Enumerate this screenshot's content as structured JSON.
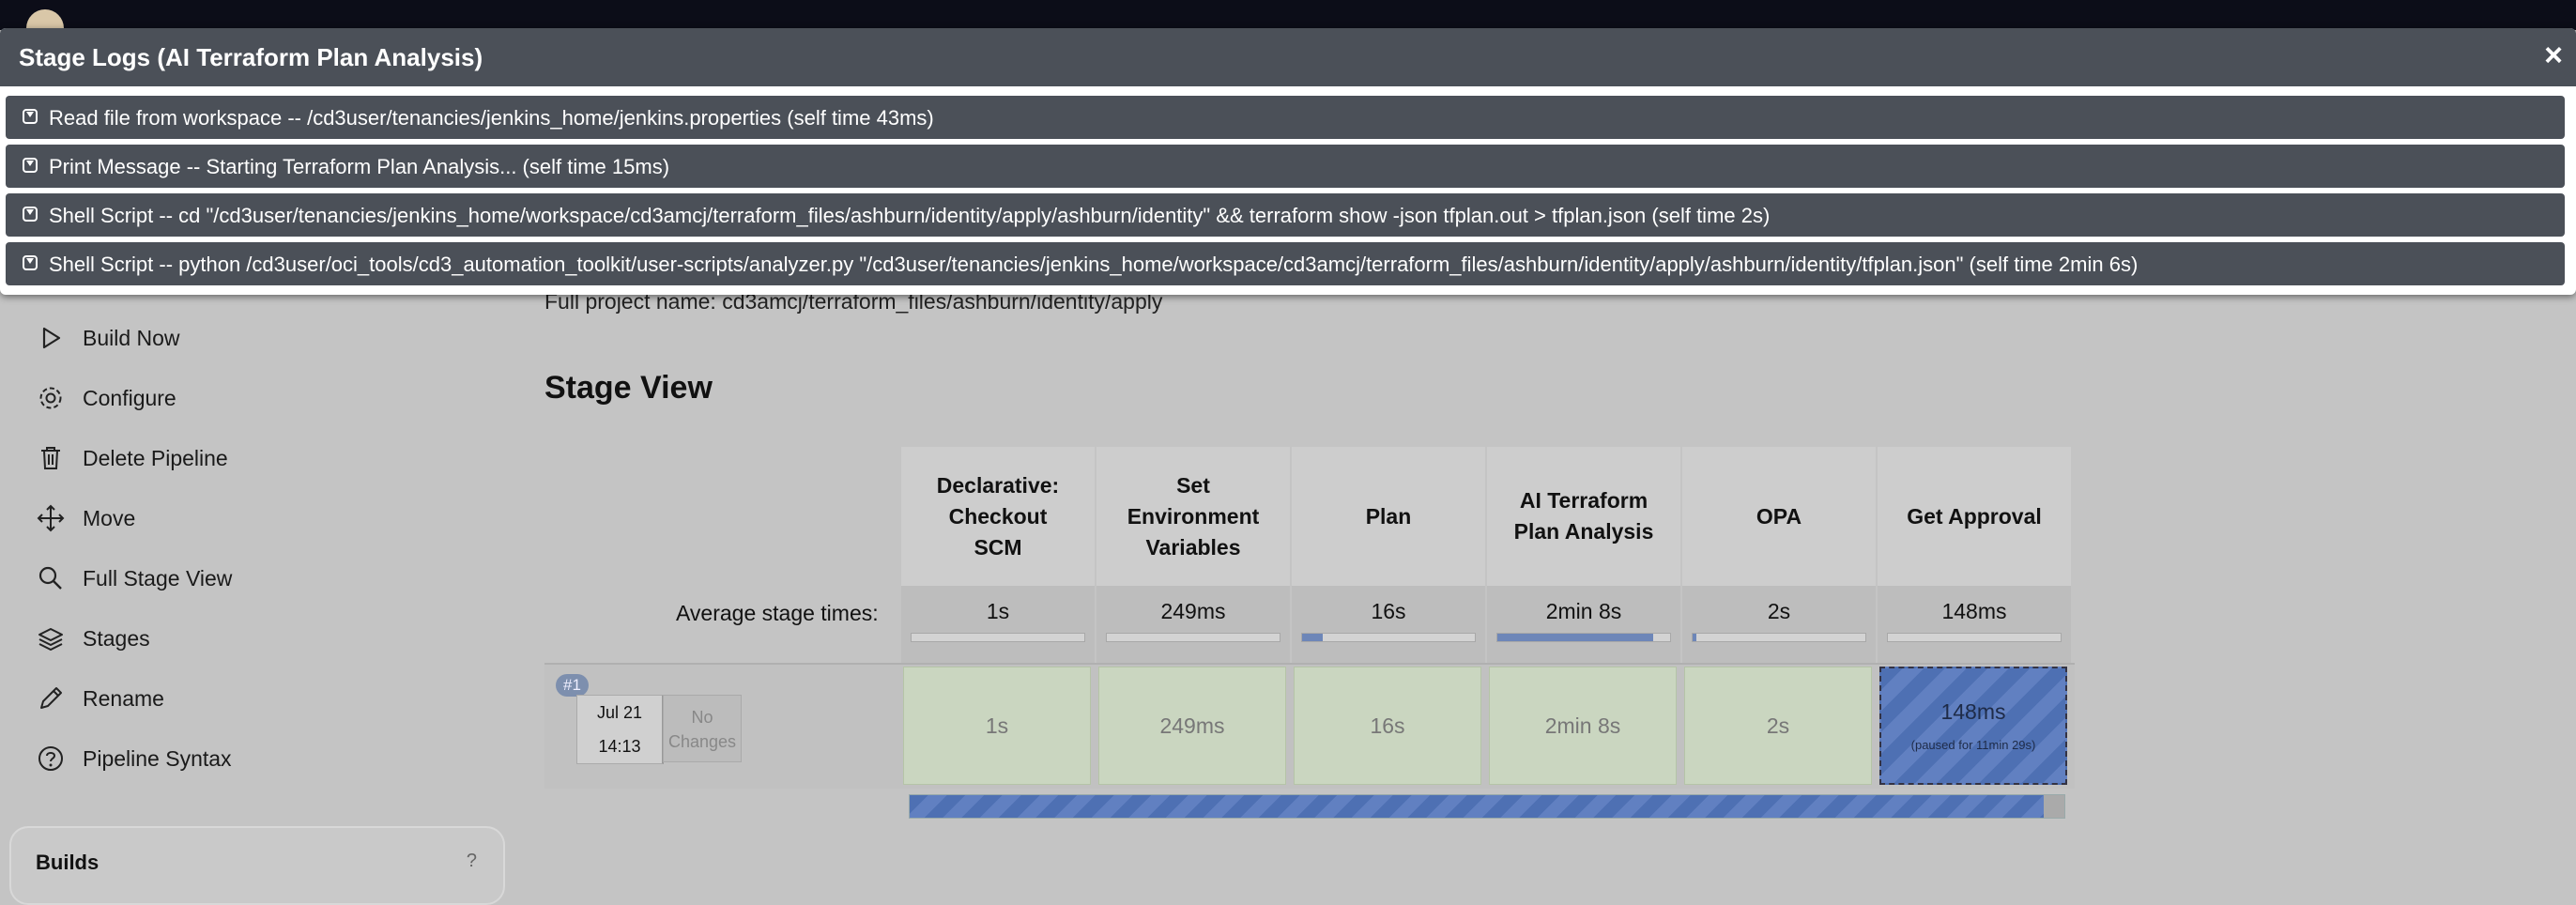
{
  "modal": {
    "title": "Stage Logs (AI Terraform Plan Analysis)",
    "close_glyph": "×",
    "logs": [
      {
        "text": "Read file from workspace -- /cd3user/tenancies/jenkins_home/jenkins.properties (self time 43ms)"
      },
      {
        "text": "Print Message -- Starting Terraform Plan Analysis... (self time 15ms)"
      },
      {
        "text": "Shell Script -- cd \"/cd3user/tenancies/jenkins_home/workspace/cd3amcj/terraform_files/ashburn/identity/apply/ashburn/identity\" && terraform show -json tfplan.out > tfplan.json (self time 2s)"
      },
      {
        "text": "Shell Script -- python /cd3user/oci_tools/cd3_automation_toolkit/user-scripts/analyzer.py \"/cd3user/tenancies/jenkins_home/workspace/cd3amcj/terraform_files/ashburn/identity/apply/ashburn/identity/tfplan.json\" (self time 2min 6s)"
      }
    ]
  },
  "sidebar": {
    "items": [
      {
        "label": "Build Now",
        "icon": "play-icon"
      },
      {
        "label": "Configure",
        "icon": "gear-icon"
      },
      {
        "label": "Delete Pipeline",
        "icon": "trash-icon"
      },
      {
        "label": "Move",
        "icon": "move-arrows-icon"
      },
      {
        "label": "Full Stage View",
        "icon": "search-icon"
      },
      {
        "label": "Stages",
        "icon": "layers-icon"
      },
      {
        "label": "Rename",
        "icon": "pencil-icon"
      },
      {
        "label": "Pipeline Syntax",
        "icon": "help-icon"
      }
    ],
    "builds_title": "Builds",
    "builds_count": "?"
  },
  "main": {
    "full_project_name": "Full project name: cd3amcj/terraform_files/ashburn/identity/apply",
    "stage_view_title": "Stage View",
    "avg_label": "Average stage times:",
    "stages": [
      {
        "name": "Declarative: Checkout SCM",
        "avg": "1s",
        "avg_fraction": 0.0
      },
      {
        "name": "Set Environment Variables",
        "avg": "249ms",
        "avg_fraction": 0.0
      },
      {
        "name": "Plan",
        "avg": "16s",
        "avg_fraction": 0.12
      },
      {
        "name": "AI Terraform Plan Analysis",
        "avg": "2min 8s",
        "avg_fraction": 0.9
      },
      {
        "name": "OPA",
        "avg": "2s",
        "avg_fraction": 0.02
      },
      {
        "name": "Get Approval",
        "avg": "148ms",
        "avg_fraction": 0.0
      }
    ],
    "run": {
      "badge": "#1",
      "date": "Jul 21",
      "time": "14:13",
      "changes": "No Changes",
      "cells": [
        "1s",
        "249ms",
        "16s",
        "2min 8s",
        "2s",
        "148ms"
      ],
      "paused_note": "(paused for 11min 29s)"
    }
  },
  "colors": {
    "modal_header": "#4b5058",
    "progress_blue": "#4e70b3",
    "success_cell": "#cad6c0"
  }
}
